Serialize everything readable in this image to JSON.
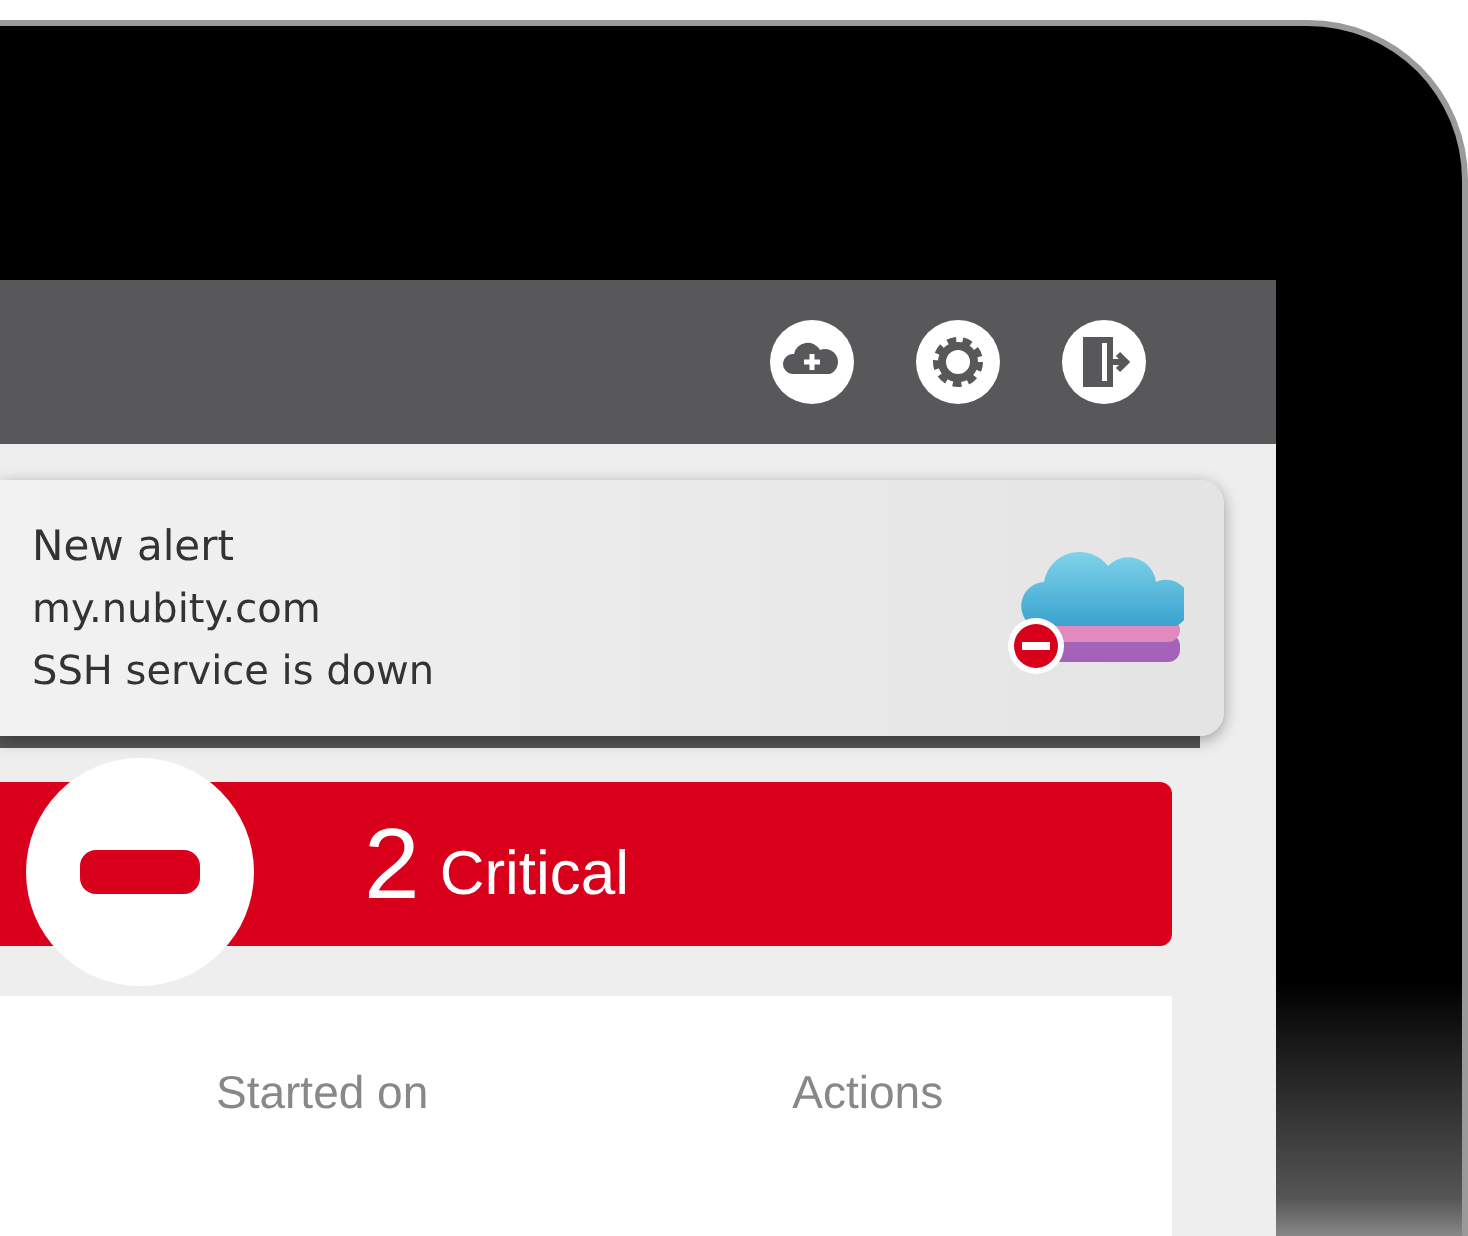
{
  "notification": {
    "title": "New alert",
    "host": "my.nubity.com",
    "message": "SSH service is down"
  },
  "status_banner": {
    "count": "2",
    "label": "Critical"
  },
  "table": {
    "columns": [
      "Started on",
      "Actions"
    ]
  }
}
